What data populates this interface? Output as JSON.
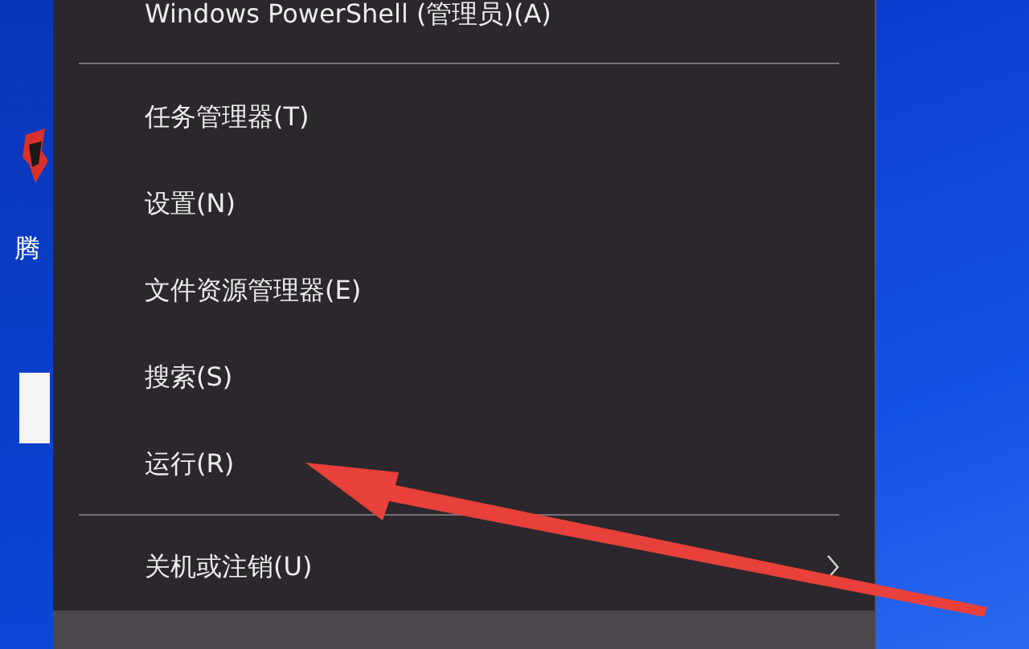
{
  "desktop": {
    "icon_label": "腾"
  },
  "menu": {
    "items": [
      {
        "kind": "item",
        "label": "Windows PowerShell (管理员)(A)",
        "selected": false
      },
      {
        "kind": "separator"
      },
      {
        "kind": "item",
        "label": "任务管理器(T)",
        "selected": false
      },
      {
        "kind": "item",
        "label": "设置(N)",
        "selected": false
      },
      {
        "kind": "item",
        "label": "文件资源管理器(E)",
        "selected": false
      },
      {
        "kind": "item",
        "label": "搜索(S)",
        "selected": false
      },
      {
        "kind": "item",
        "label": "运行(R)",
        "selected": false
      },
      {
        "kind": "separator"
      },
      {
        "kind": "submenu",
        "label": "关机或注销(U)",
        "selected": false
      },
      {
        "kind": "item",
        "selected": true
      }
    ]
  }
}
